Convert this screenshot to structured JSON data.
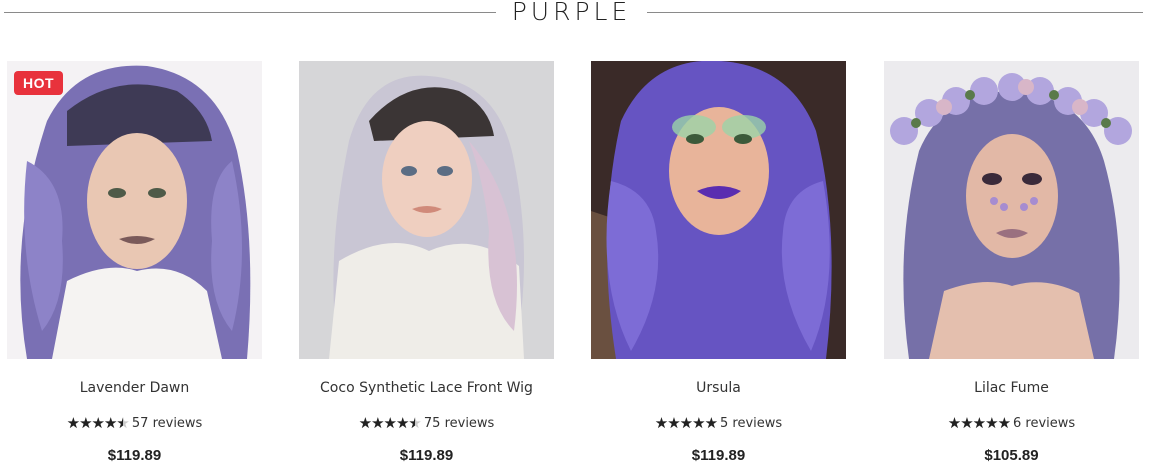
{
  "section": {
    "title": "PURPLE"
  },
  "products": [
    {
      "name": "Lavender Dawn",
      "badge": "HOT",
      "rating": 4.5,
      "reviews": "57 reviews",
      "price": "$119.89",
      "image_alt": "Model with curly lavender purple wig"
    },
    {
      "name": "Coco Synthetic Lace Front Wig",
      "badge": "",
      "rating": 4.5,
      "reviews": "75 reviews",
      "price": "$119.89",
      "image_alt": "Model with silver pastel wig"
    },
    {
      "name": "Ursula",
      "badge": "",
      "rating": 5,
      "reviews": "5 reviews",
      "price": "$119.89",
      "image_alt": "Model with violet wig and purple lipstick"
    },
    {
      "name": "Lilac Fume",
      "badge": "",
      "rating": 5,
      "reviews": "6 reviews",
      "price": "$105.89",
      "image_alt": "Model with lilac wig and flower crown"
    }
  ],
  "colors": {
    "badge": "#e8323c",
    "star_fill": "#222222",
    "star_empty": "#cccccc"
  }
}
